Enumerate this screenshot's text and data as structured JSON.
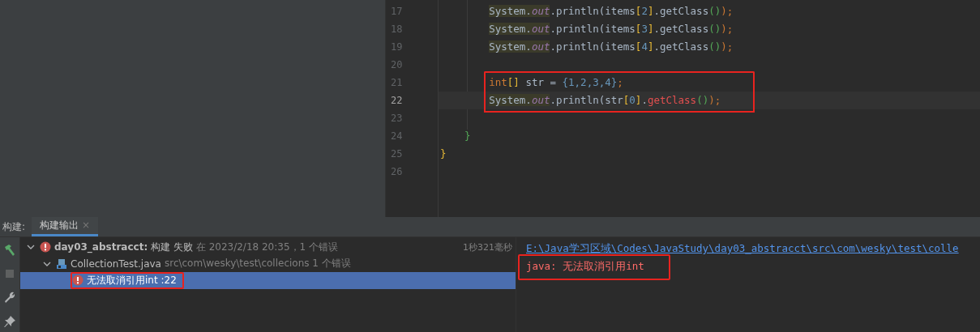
{
  "editor": {
    "lines": [
      {
        "number": "17",
        "current": false,
        "annotated": false,
        "tokens": [
          {
            "text": "        System.",
            "kind": "hl"
          },
          {
            "text": "out",
            "kind": "field-hl"
          },
          {
            "text": ".println(items"
          },
          {
            "text": "[",
            "kind": "bracket"
          },
          {
            "text": "2",
            "kind": "number"
          },
          {
            "text": "]",
            "kind": "bracket"
          },
          {
            "text": ".getClass"
          },
          {
            "text": "()",
            "kind": "paren"
          },
          {
            "text": ");",
            "kind": "punct"
          }
        ]
      },
      {
        "number": "18",
        "current": false,
        "annotated": false,
        "tokens": [
          {
            "text": "        System.",
            "kind": "hl"
          },
          {
            "text": "out",
            "kind": "field-hl"
          },
          {
            "text": ".println(items"
          },
          {
            "text": "[",
            "kind": "bracket"
          },
          {
            "text": "3",
            "kind": "number"
          },
          {
            "text": "]",
            "kind": "bracket"
          },
          {
            "text": ".getClass"
          },
          {
            "text": "()",
            "kind": "paren"
          },
          {
            "text": ");",
            "kind": "punct"
          }
        ]
      },
      {
        "number": "19",
        "current": false,
        "annotated": false,
        "tokens": [
          {
            "text": "        System.",
            "kind": "hl"
          },
          {
            "text": "out",
            "kind": "field-hl"
          },
          {
            "text": ".println(items"
          },
          {
            "text": "[",
            "kind": "bracket"
          },
          {
            "text": "4",
            "kind": "number"
          },
          {
            "text": "]",
            "kind": "bracket"
          },
          {
            "text": ".getClass"
          },
          {
            "text": "()",
            "kind": "paren"
          },
          {
            "text": ");",
            "kind": "punct"
          }
        ]
      },
      {
        "number": "20",
        "current": false,
        "annotated": false
      },
      {
        "number": "21",
        "current": false,
        "annotated": true,
        "tokens": [
          {
            "text": "        int",
            "kind": "keyword"
          },
          {
            "text": "[]",
            "kind": "bracket"
          },
          {
            "text": " str = "
          },
          {
            "text": "{1,2,3,4}",
            "kind": "number"
          },
          {
            "text": ";",
            "kind": "punct"
          }
        ]
      },
      {
        "number": "22",
        "current": true,
        "annotated": true,
        "tokens": [
          {
            "text": "        System.",
            "kind": "hl"
          },
          {
            "text": "out",
            "kind": "field-hl"
          },
          {
            "text": ".println(str"
          },
          {
            "text": "[",
            "kind": "bracket"
          },
          {
            "text": "0",
            "kind": "number"
          },
          {
            "text": "]",
            "kind": "bracket"
          },
          {
            "text": "."
          },
          {
            "text": "getClass",
            "kind": "error"
          },
          {
            "text": "()",
            "kind": "paren"
          },
          {
            "text": ");",
            "kind": "punct"
          }
        ]
      },
      {
        "number": "23",
        "current": false,
        "annotated": false
      },
      {
        "number": "24",
        "current": false,
        "annotated": false,
        "tokens": [
          {
            "text": "    }",
            "kind": "paren"
          }
        ]
      },
      {
        "number": "25",
        "current": false,
        "annotated": false,
        "tokens": [
          {
            "text": "}",
            "kind": "bracket"
          }
        ]
      },
      {
        "number": "26",
        "current": false,
        "annotated": false
      }
    ]
  },
  "build": {
    "label": "构建:",
    "tabs": [
      {
        "label": "构建输出",
        "close": "×",
        "selected": true
      }
    ],
    "tree": [
      {
        "kind": "error",
        "title": "**day03_abstracct:** 构建 失败",
        "detail": "在 2023/2/18 20:35，1 个错误",
        "time": "1秒321毫秒",
        "expanded": true,
        "selected": false,
        "annotated": false,
        "children": [
          {
            "kind": "java-file",
            "title": "CollectionTest.java",
            "detail": "src\\com\\wesky\\test\\collecions 1 个错误",
            "expanded": true,
            "selected": false,
            "annotated": false,
            "children": [
              {
                "kind": "error",
                "title": "无法取消引用int :22",
                "selected": true,
                "annotated": true
              }
            ]
          }
        ]
      }
    ],
    "console": [
      {
        "kind": "link",
        "text": "E:\\Java学习区域\\Codes\\JavaStudy\\day03_abstracct\\src\\com\\wesky\\test\\colle",
        "annotated": false
      },
      {
        "kind": "error",
        "text": "java: 无法取消引用int",
        "annotated": true
      }
    ]
  }
}
